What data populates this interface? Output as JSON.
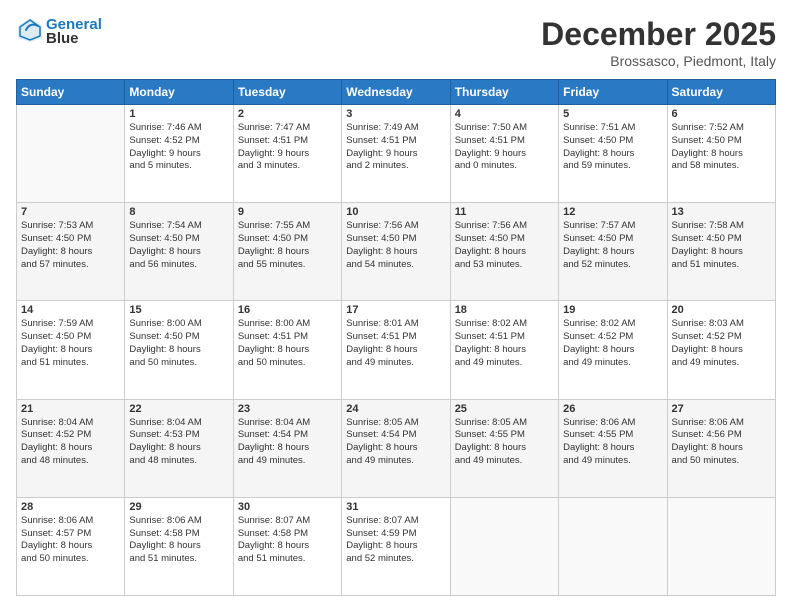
{
  "header": {
    "logo_line1": "General",
    "logo_line2": "Blue",
    "month": "December 2025",
    "location": "Brossasco, Piedmont, Italy"
  },
  "weekdays": [
    "Sunday",
    "Monday",
    "Tuesday",
    "Wednesday",
    "Thursday",
    "Friday",
    "Saturday"
  ],
  "weeks": [
    [
      {
        "day": "",
        "info": ""
      },
      {
        "day": "1",
        "info": "Sunrise: 7:46 AM\nSunset: 4:52 PM\nDaylight: 9 hours\nand 5 minutes."
      },
      {
        "day": "2",
        "info": "Sunrise: 7:47 AM\nSunset: 4:51 PM\nDaylight: 9 hours\nand 3 minutes."
      },
      {
        "day": "3",
        "info": "Sunrise: 7:49 AM\nSunset: 4:51 PM\nDaylight: 9 hours\nand 2 minutes."
      },
      {
        "day": "4",
        "info": "Sunrise: 7:50 AM\nSunset: 4:51 PM\nDaylight: 9 hours\nand 0 minutes."
      },
      {
        "day": "5",
        "info": "Sunrise: 7:51 AM\nSunset: 4:50 PM\nDaylight: 8 hours\nand 59 minutes."
      },
      {
        "day": "6",
        "info": "Sunrise: 7:52 AM\nSunset: 4:50 PM\nDaylight: 8 hours\nand 58 minutes."
      }
    ],
    [
      {
        "day": "7",
        "info": "Sunrise: 7:53 AM\nSunset: 4:50 PM\nDaylight: 8 hours\nand 57 minutes."
      },
      {
        "day": "8",
        "info": "Sunrise: 7:54 AM\nSunset: 4:50 PM\nDaylight: 8 hours\nand 56 minutes."
      },
      {
        "day": "9",
        "info": "Sunrise: 7:55 AM\nSunset: 4:50 PM\nDaylight: 8 hours\nand 55 minutes."
      },
      {
        "day": "10",
        "info": "Sunrise: 7:56 AM\nSunset: 4:50 PM\nDaylight: 8 hours\nand 54 minutes."
      },
      {
        "day": "11",
        "info": "Sunrise: 7:56 AM\nSunset: 4:50 PM\nDaylight: 8 hours\nand 53 minutes."
      },
      {
        "day": "12",
        "info": "Sunrise: 7:57 AM\nSunset: 4:50 PM\nDaylight: 8 hours\nand 52 minutes."
      },
      {
        "day": "13",
        "info": "Sunrise: 7:58 AM\nSunset: 4:50 PM\nDaylight: 8 hours\nand 51 minutes."
      }
    ],
    [
      {
        "day": "14",
        "info": "Sunrise: 7:59 AM\nSunset: 4:50 PM\nDaylight: 8 hours\nand 51 minutes."
      },
      {
        "day": "15",
        "info": "Sunrise: 8:00 AM\nSunset: 4:50 PM\nDaylight: 8 hours\nand 50 minutes."
      },
      {
        "day": "16",
        "info": "Sunrise: 8:00 AM\nSunset: 4:51 PM\nDaylight: 8 hours\nand 50 minutes."
      },
      {
        "day": "17",
        "info": "Sunrise: 8:01 AM\nSunset: 4:51 PM\nDaylight: 8 hours\nand 49 minutes."
      },
      {
        "day": "18",
        "info": "Sunrise: 8:02 AM\nSunset: 4:51 PM\nDaylight: 8 hours\nand 49 minutes."
      },
      {
        "day": "19",
        "info": "Sunrise: 8:02 AM\nSunset: 4:52 PM\nDaylight: 8 hours\nand 49 minutes."
      },
      {
        "day": "20",
        "info": "Sunrise: 8:03 AM\nSunset: 4:52 PM\nDaylight: 8 hours\nand 49 minutes."
      }
    ],
    [
      {
        "day": "21",
        "info": "Sunrise: 8:04 AM\nSunset: 4:52 PM\nDaylight: 8 hours\nand 48 minutes."
      },
      {
        "day": "22",
        "info": "Sunrise: 8:04 AM\nSunset: 4:53 PM\nDaylight: 8 hours\nand 48 minutes."
      },
      {
        "day": "23",
        "info": "Sunrise: 8:04 AM\nSunset: 4:54 PM\nDaylight: 8 hours\nand 49 minutes."
      },
      {
        "day": "24",
        "info": "Sunrise: 8:05 AM\nSunset: 4:54 PM\nDaylight: 8 hours\nand 49 minutes."
      },
      {
        "day": "25",
        "info": "Sunrise: 8:05 AM\nSunset: 4:55 PM\nDaylight: 8 hours\nand 49 minutes."
      },
      {
        "day": "26",
        "info": "Sunrise: 8:06 AM\nSunset: 4:55 PM\nDaylight: 8 hours\nand 49 minutes."
      },
      {
        "day": "27",
        "info": "Sunrise: 8:06 AM\nSunset: 4:56 PM\nDaylight: 8 hours\nand 50 minutes."
      }
    ],
    [
      {
        "day": "28",
        "info": "Sunrise: 8:06 AM\nSunset: 4:57 PM\nDaylight: 8 hours\nand 50 minutes."
      },
      {
        "day": "29",
        "info": "Sunrise: 8:06 AM\nSunset: 4:58 PM\nDaylight: 8 hours\nand 51 minutes."
      },
      {
        "day": "30",
        "info": "Sunrise: 8:07 AM\nSunset: 4:58 PM\nDaylight: 8 hours\nand 51 minutes."
      },
      {
        "day": "31",
        "info": "Sunrise: 8:07 AM\nSunset: 4:59 PM\nDaylight: 8 hours\nand 52 minutes."
      },
      {
        "day": "",
        "info": ""
      },
      {
        "day": "",
        "info": ""
      },
      {
        "day": "",
        "info": ""
      }
    ]
  ]
}
